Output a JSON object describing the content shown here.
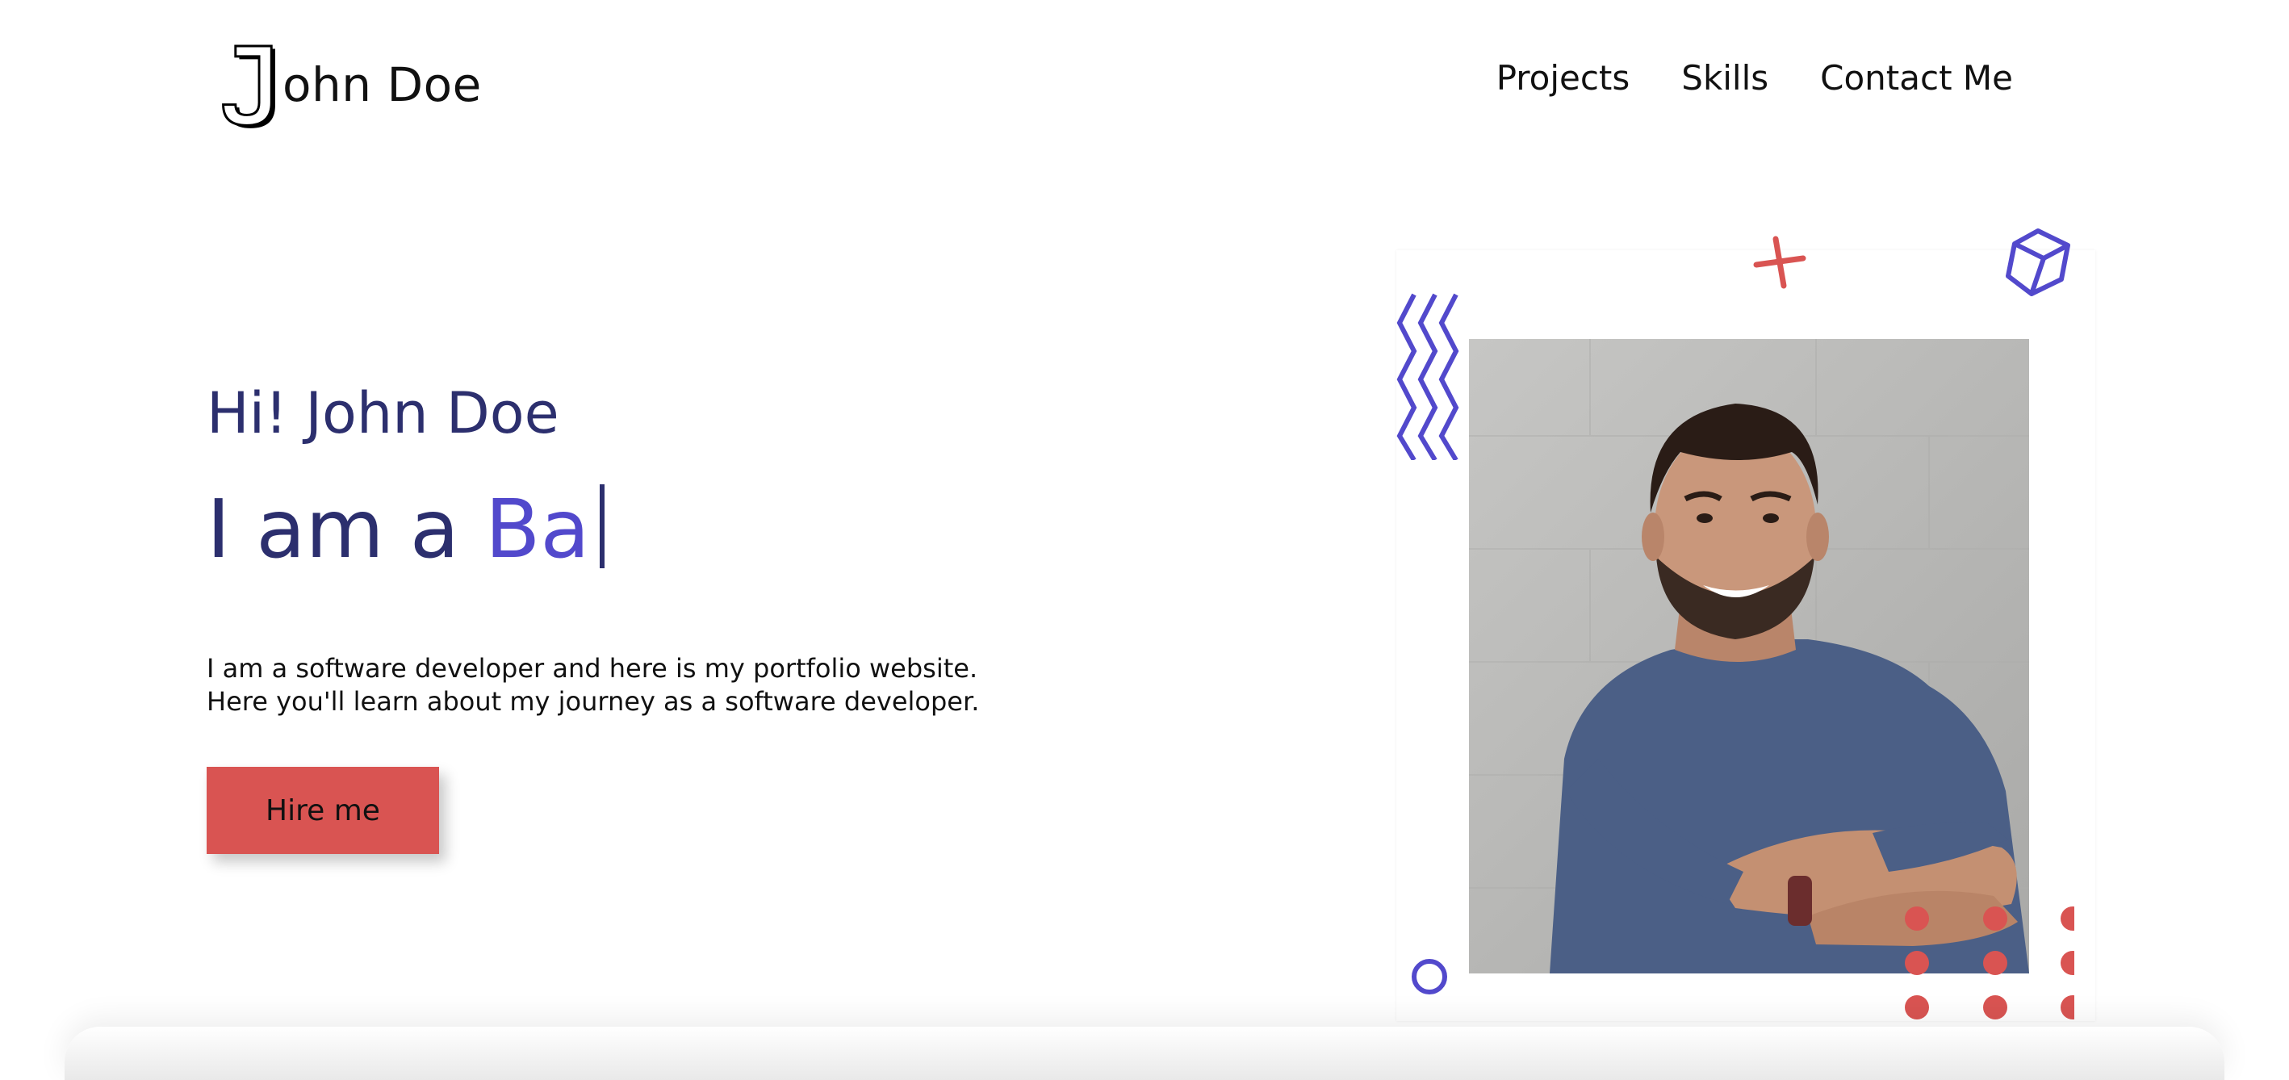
{
  "header": {
    "logo_text": "ohn Doe",
    "nav": [
      {
        "label": "Projects"
      },
      {
        "label": "Skills"
      },
      {
        "label": "Contact Me"
      }
    ]
  },
  "hero": {
    "greeting": "Hi! John Doe",
    "typed_prefix": "I am a ",
    "typed_word": "Ba",
    "intro_line1": "I am a software developer and here is my portfolio website.",
    "intro_line2": "Here you'll learn about my journey as a software developer.",
    "cta_label": "Hire me"
  },
  "colors": {
    "primary_text": "#2c2f6e",
    "accent": "#5249cc",
    "cta": "#d95452"
  },
  "icons": [
    "logo-j-icon",
    "zigzag-icon",
    "plus-icon",
    "cube-icon",
    "circle-icon",
    "dot-grid-icon"
  ]
}
